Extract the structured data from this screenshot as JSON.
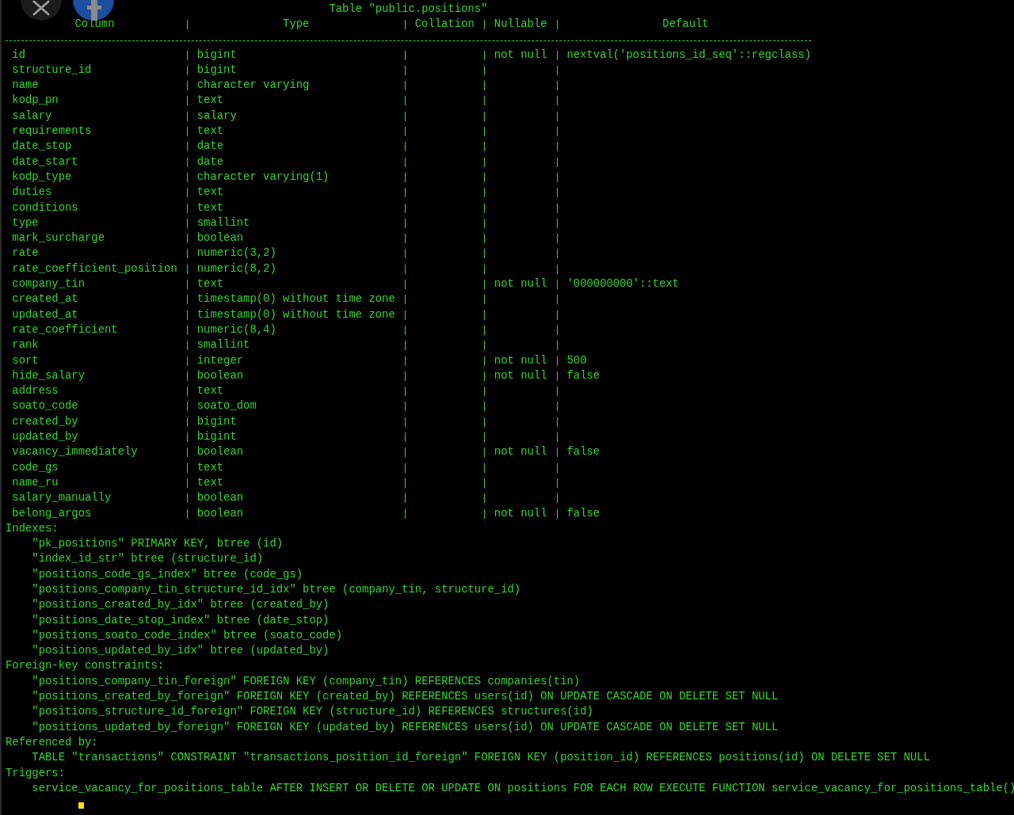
{
  "title": "Table \"public.positions\"",
  "columns": [
    "Column",
    "Type",
    "Collation",
    "Nullable",
    "Default"
  ],
  "rows": [
    {
      "column": "id",
      "type": "bigint",
      "nullable": "not null",
      "default": "nextval('positions_id_seq'::regclass)"
    },
    {
      "column": "structure_id",
      "type": "bigint"
    },
    {
      "column": "name",
      "type": "character varying"
    },
    {
      "column": "kodp_pn",
      "type": "text"
    },
    {
      "column": "salary",
      "type": "salary"
    },
    {
      "column": "requirements",
      "type": "text"
    },
    {
      "column": "date_stop",
      "type": "date"
    },
    {
      "column": "date_start",
      "type": "date"
    },
    {
      "column": "kodp_type",
      "type": "character varying(1)"
    },
    {
      "column": "duties",
      "type": "text"
    },
    {
      "column": "conditions",
      "type": "text"
    },
    {
      "column": "type",
      "type": "smallint"
    },
    {
      "column": "mark_surcharge",
      "type": "boolean"
    },
    {
      "column": "rate",
      "type": "numeric(3,2)"
    },
    {
      "column": "rate_coefficient_position",
      "type": "numeric(8,2)"
    },
    {
      "column": "company_tin",
      "type": "text",
      "nullable": "not null",
      "default": "'000000000'::text"
    },
    {
      "column": "created_at",
      "type": "timestamp(0) without time zone"
    },
    {
      "column": "updated_at",
      "type": "timestamp(0) without time zone"
    },
    {
      "column": "rate_coefficient",
      "type": "numeric(8,4)"
    },
    {
      "column": "rank",
      "type": "smallint"
    },
    {
      "column": "sort",
      "type": "integer",
      "nullable": "not null",
      "default": "500"
    },
    {
      "column": "hide_salary",
      "type": "boolean",
      "nullable": "not null",
      "default": "false"
    },
    {
      "column": "address",
      "type": "text"
    },
    {
      "column": "soato_code",
      "type": "soato_dom"
    },
    {
      "column": "created_by",
      "type": "bigint"
    },
    {
      "column": "updated_by",
      "type": "bigint"
    },
    {
      "column": "vacancy_immediately",
      "type": "boolean",
      "nullable": "not null",
      "default": "false"
    },
    {
      "column": "code_gs",
      "type": "text"
    },
    {
      "column": "name_ru",
      "type": "text"
    },
    {
      "column": "salary_manually",
      "type": "boolean"
    },
    {
      "column": "belong_argos",
      "type": "boolean",
      "nullable": "not null",
      "default": "false"
    }
  ],
  "sections": [
    {
      "heading": "Indexes:",
      "lines": [
        "\"pk_positions\" PRIMARY KEY, btree (id)",
        "\"index_id_str\" btree (structure_id)",
        "\"positions_code_gs_index\" btree (code_gs)",
        "\"positions_company_tin_structure_id_idx\" btree (company_tin, structure_id)",
        "\"positions_created_by_idx\" btree (created_by)",
        "\"positions_date_stop_index\" btree (date_stop)",
        "\"positions_soato_code_index\" btree (soato_code)",
        "\"positions_updated_by_idx\" btree (updated_by)"
      ]
    },
    {
      "heading": "Foreign-key constraints:",
      "lines": [
        "\"positions_company_tin_foreign\" FOREIGN KEY (company_tin) REFERENCES companies(tin)",
        "\"positions_created_by_foreign\" FOREIGN KEY (created_by) REFERENCES users(id) ON UPDATE CASCADE ON DELETE SET NULL",
        "\"positions_structure_id_foreign\" FOREIGN KEY (structure_id) REFERENCES structures(id)",
        "\"positions_updated_by_foreign\" FOREIGN KEY (updated_by) REFERENCES users(id) ON UPDATE CASCADE ON DELETE SET NULL"
      ]
    },
    {
      "heading": "Referenced by:",
      "lines": [
        "TABLE \"transactions\" CONSTRAINT \"transactions_position_id_foreign\" FOREIGN KEY (position_id) REFERENCES positions(id) ON DELETE SET NULL"
      ]
    },
    {
      "heading": "Triggers:",
      "lines": [
        "service_vacancy_for_positions_table AFTER INSERT OR DELETE OR UPDATE ON positions FOR EACH ROW EXECUTE FUNCTION service_vacancy_for_positions_table()"
      ]
    }
  ]
}
